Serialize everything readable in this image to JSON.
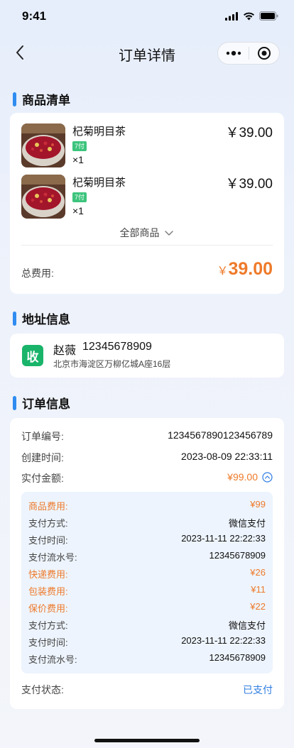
{
  "status_bar": {
    "time": "9:41"
  },
  "nav": {
    "title": "订单详情"
  },
  "goods_section": {
    "title": "商品清单",
    "items": [
      {
        "name": "杞菊明目茶",
        "tag": "7付",
        "qty": "×1",
        "price": "￥39.00"
      },
      {
        "name": "杞菊明目茶",
        "tag": "7付",
        "qty": "×1",
        "price": "￥39.00"
      }
    ],
    "all_goods_label": "全部商品",
    "total_label": "总费用:",
    "total_currency": "￥",
    "total_amount": "39.00"
  },
  "address_section": {
    "title": "地址信息",
    "icon_text": "收",
    "name": "赵薇",
    "phone": "12345678909",
    "detail": "北京市海淀区万柳亿城A座16层"
  },
  "order_section": {
    "title": "订单信息",
    "order_no_label": "订单编号:",
    "order_no": "1234567890123456789",
    "created_label": "创建时间:",
    "created": "2023-08-09 22:33:11",
    "paid_label": "实付金额:",
    "paid": "¥99.00",
    "breakdown": [
      {
        "label": "商品费用:",
        "value": "¥99",
        "highlight": true
      },
      {
        "label": "支付方式:",
        "value": "微信支付",
        "highlight": false
      },
      {
        "label": "支付时间:",
        "value": "2023-11-11 22:22:33",
        "highlight": false
      },
      {
        "label": "支付流水号:",
        "value": "12345678909",
        "highlight": false
      },
      {
        "label": "快递费用:",
        "value": "¥26",
        "highlight": true
      },
      {
        "label": "包装费用:",
        "value": "¥11",
        "highlight": true
      },
      {
        "label": "保价费用:",
        "value": "¥22",
        "highlight": true
      },
      {
        "label": "支付方式:",
        "value": "微信支付",
        "highlight": false
      },
      {
        "label": "支付时间:",
        "value": "2023-11-11 22:22:33",
        "highlight": false
      },
      {
        "label": "支付流水号:",
        "value": "12345678909",
        "highlight": false
      }
    ],
    "pay_status_label": "支付状态:",
    "pay_status": "已支付"
  },
  "colors": {
    "accent_blue": "#2f8cf0",
    "price_orange": "#ee7a2a",
    "status_blue": "#2f7de1",
    "tag_green": "#3cc47c",
    "address_icon_green": "#19b46a"
  },
  "icons": [
    "signal-icon",
    "wifi-icon",
    "battery-icon",
    "back-arrow-icon",
    "more-icon",
    "close-target-icon",
    "chevron-down-icon",
    "chevron-up-circle-icon"
  ]
}
